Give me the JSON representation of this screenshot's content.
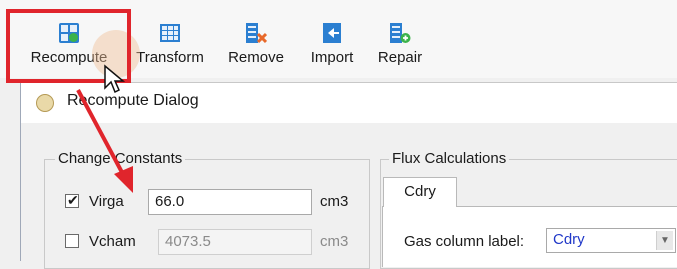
{
  "toolbar": {
    "items": [
      {
        "label": "Recompute",
        "icon": "recompute-icon"
      },
      {
        "label": "Transform",
        "icon": "transform-icon"
      },
      {
        "label": "Remove",
        "icon": "remove-icon"
      },
      {
        "label": "Import",
        "icon": "import-icon"
      },
      {
        "label": "Repair",
        "icon": "repair-icon"
      }
    ]
  },
  "dialog": {
    "title": "Recompute Dialog",
    "change_constants": {
      "title": "Change Constants",
      "rows": [
        {
          "label": "Virga",
          "checked": true,
          "value": "66.0",
          "unit": "cm3"
        },
        {
          "label": "Vcham",
          "checked": false,
          "value": "4073.5",
          "unit": "cm3"
        }
      ]
    },
    "flux": {
      "title": "Flux Calculations",
      "tab": "Cdry",
      "gas_label": "Gas column label:",
      "gas_value": "Cdry"
    }
  },
  "colors": {
    "highlight": "#e0252c",
    "annotation_arrow": "#e0252c"
  }
}
